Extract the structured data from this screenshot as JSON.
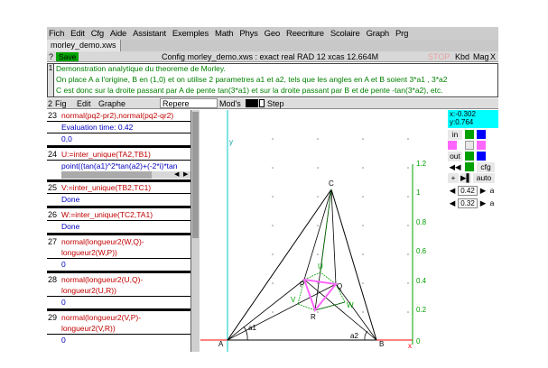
{
  "menu": [
    "Fich",
    "Edit",
    "Cfg",
    "Aide",
    "Assistant",
    "Exemples",
    "Math",
    "Phys",
    "Geo",
    "Reecriture",
    "Scolaire",
    "Graph",
    "Prg"
  ],
  "tab": "morley_demo.xws",
  "toolbar": {
    "help": "?",
    "save": "Save",
    "config": "Config morley_demo.xws : exact real RAD 12 xcas 12.664M",
    "stop": "STOP",
    "kbd": "Kbd",
    "mag": "Mag",
    "close": "X"
  },
  "comment": {
    "num": "1",
    "lines": [
      "Demonstration analytique du theoreme de Morley.",
      "On place A a l'origine, B en (1,0) et on utilise 2 parametres a1 et a2, tels que les angles en A et B soient 3*a1 , 3*a2",
      "C est donc sur la droite passant par A de pente tan(3*a1) et sur la droite passant par B et de pente -tan(3*a2), etc."
    ]
  },
  "figbar": {
    "num": "2",
    "fig": "Fig",
    "edit": "Edit",
    "graphe": "Graphe",
    "repere": "Repere",
    "mode": "Mod's",
    "step": "Step"
  },
  "history": [
    {
      "n": "23",
      "in": [
        "normal(pq2-pr2),normal(pq2-qr2)"
      ],
      "out": [
        "Evaluation time: 0.42",
        "0,0"
      ]
    },
    {
      "n": "24",
      "in": [
        "U:=inter_unique(TA2,TB1)"
      ],
      "out": [
        "point((tan(a1)^2*tan(a2)+(-2*i)*tan"
      ]
    },
    {
      "n": "25",
      "in": [
        "V:=inter_unique(TB2,TC1)"
      ],
      "out": [
        "Done"
      ]
    },
    {
      "n": "26",
      "in": [
        "W:=inter_unique(TC2,TA1)"
      ],
      "out": [
        "Done"
      ]
    },
    {
      "n": "27",
      "in": [
        "normal(longueur2(W,Q)-",
        "longueur2(W,P))"
      ],
      "out": [
        "0"
      ]
    },
    {
      "n": "28",
      "in": [
        "normal(longueur2(U,Q)-",
        "longueur2(U,R))"
      ],
      "out": [
        "0"
      ]
    },
    {
      "n": "29",
      "in": [
        "normal(longueur2(V,P)-",
        "longueur2(V,R))"
      ],
      "out": [
        "0"
      ]
    }
  ],
  "graph": {
    "y_axis_label": "y",
    "x_axis_label": "x",
    "y_ticks": [
      "1.2",
      "1",
      "0.8",
      "0.6",
      "0.4",
      "0.2",
      "0"
    ],
    "points": {
      "A": "A",
      "B": "B",
      "C": "C",
      "P": "P",
      "Q": "Q",
      "R": "R",
      "U": "U",
      "V": "V",
      "W": "W"
    },
    "angle1": "a1",
    "angle2": "a2"
  },
  "sidepanel": {
    "coords": [
      "x:-0.302",
      "y:0.764"
    ],
    "in": "in",
    "out": "out",
    "cfg": "cfg",
    "plus": "+",
    "auto": "auto",
    "param1": "0.42",
    "param2": "0.32",
    "param_label": "a",
    "colors": {
      "blue": "#0000ff",
      "green": "#00a000",
      "magenta": "#ff66ff"
    }
  }
}
